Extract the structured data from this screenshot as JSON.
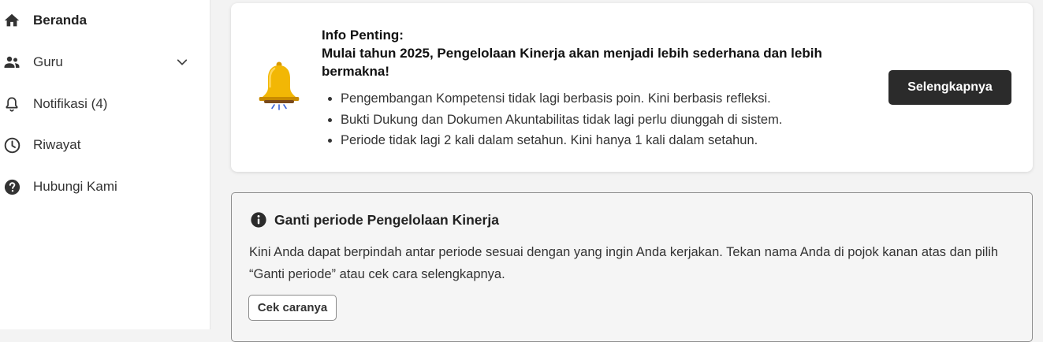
{
  "sidebar": {
    "items": [
      {
        "label": "Beranda",
        "icon": "home-icon",
        "active": true
      },
      {
        "label": "Guru",
        "icon": "people-icon",
        "expandable": true
      },
      {
        "label": "Notifikasi (4)",
        "icon": "bell-outline-icon"
      },
      {
        "label": "Riwayat",
        "icon": "clock-icon"
      },
      {
        "label": "Hubungi Kami",
        "icon": "help-circle-icon"
      }
    ]
  },
  "info": {
    "title": "Info Penting:",
    "subtitle": "Mulai tahun 2025, Pengelolaan Kinerja akan menjadi lebih sederhana dan lebih bermakna!",
    "points": [
      "Pengembangan Kompetensi tidak lagi berbasis poin. Kini berbasis refleksi.",
      "Bukti Dukung dan Dokumen Akuntabilitas tidak lagi perlu diunggah di sistem.",
      "Periode tidak lagi 2 kali dalam setahun. Kini hanya 1 kali dalam setahun."
    ],
    "button_label": "Selengkapnya",
    "icon": "bell-icon"
  },
  "notice": {
    "icon": "info-icon",
    "title": "Ganti periode Pengelolaan Kinerja",
    "body": "Kini Anda dapat berpindah antar periode sesuai dengan yang ingin Anda kerjakan. Tekan nama Anda di pojok kanan atas dan pilih “Ganti periode” atau cek cara selengkapnya.",
    "button_label": "Cek caranya"
  },
  "colors": {
    "primary_button": "#2b2b2b",
    "bell": "#f2b705",
    "page_background": "#f3f3f3"
  }
}
